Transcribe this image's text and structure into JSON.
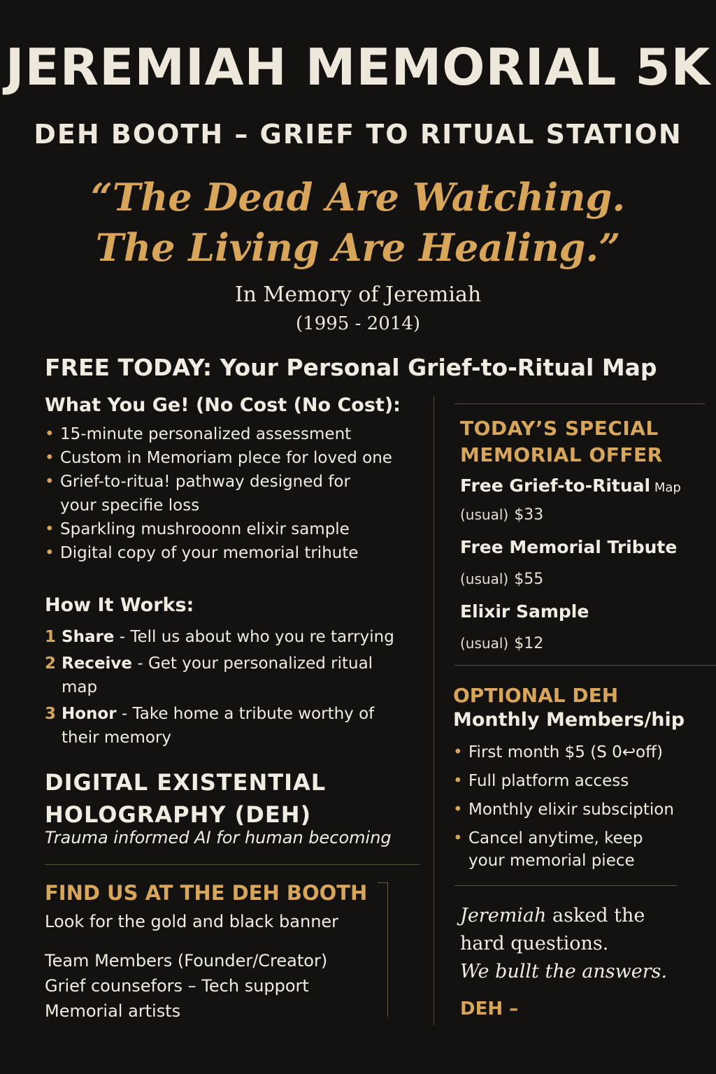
{
  "header": {
    "title": "JEREMIAH MEMORIAL 5K",
    "subtitle": "DEH BOOTH – GRIEF TO RITUAL STATION",
    "quote_line1": "“The Dead Are Watching.",
    "quote_line2": "The Living Are Healing.”",
    "memory_line": "In Memory of Jeremiah",
    "years": "(1995 - 2014)"
  },
  "free_heading": "FREE TODAY: Your Personal Grief-to-Ritual Map",
  "what_you_get": {
    "heading": "What You Ge! (No Cost (No Cost):",
    "items": [
      "15-minute personalized assessment",
      "Custom in Memoriam plece for loved one",
      "Grief-to-ritua! pathway designed for your specifie loss",
      "Sparkling mushrooonn elixir sample",
      "Digital copy of your memorial trihute"
    ]
  },
  "how_it_works": {
    "heading": "How It Works:",
    "steps": [
      {
        "num": "1",
        "label": "Share",
        "text": " - Tell us about who you re tarrying"
      },
      {
        "num": "2",
        "label": "Receive",
        "text": " - Get your personalized ritual map"
      },
      {
        "num": "3",
        "label": "Honor",
        "text": " - Take home a tribute worthy of their memory"
      }
    ]
  },
  "deh": {
    "title_line1": "DIGITAL EXISTENTIAL",
    "title_line2": "HOLOGRAPHY (DEH)",
    "tagline": "Trauma informed AI for human becoming"
  },
  "find_us": {
    "heading": "FIND US AT THE DEH BOOTH",
    "banner_text": "Look for the gold and black banner",
    "team_lines": [
      "Team Members (Founder/Creator)",
      "Grief counsefors – Tech support",
      "Memorial artists"
    ]
  },
  "special_offer": {
    "heading_line1": "TODAY’S SPECIAL",
    "heading_line2": "MEMORIAL OFFER",
    "items": [
      {
        "name": "Free Grief-to-Ritual",
        "suffix": " Map",
        "usual_label": "(usual)",
        "price": "$33"
      },
      {
        "name": "Free Memorial Tribute",
        "suffix": "",
        "usual_label": "(usual)",
        "price": "$55"
      },
      {
        "name": "Elixir Sample",
        "suffix": "",
        "usual_label": "(usual)",
        "price": "$12"
      }
    ]
  },
  "membership": {
    "heading": "OPTIONAL DEH",
    "subheading": "Monthly Members/hip",
    "items": [
      "First month $5 (S 0↩off)",
      "Full platform access",
      "Monthly elixir subsciption",
      "Cancel anytime, keep your memorial piece"
    ]
  },
  "closing": {
    "line1_name": "Jeremiah",
    "line1_rest": " asked the",
    "line2": "hard questions.",
    "line3": "We bullt the answers.",
    "signature": "DEH –"
  },
  "colors": {
    "background": "#141210",
    "gold": "#d7a65a",
    "text": "#f1ece2"
  }
}
